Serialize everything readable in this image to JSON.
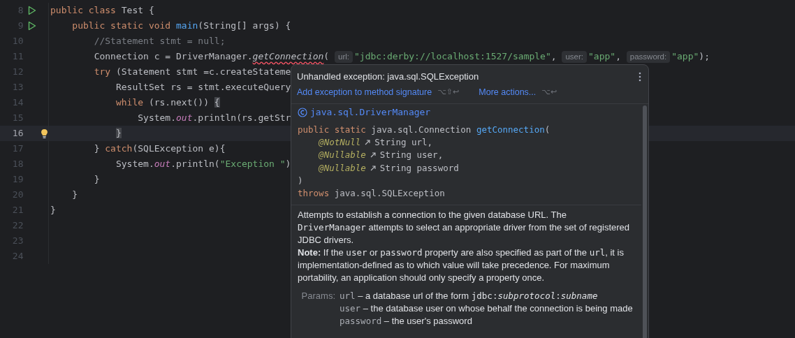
{
  "editor": {
    "lines": [
      {
        "number": "8",
        "run": true,
        "current": false,
        "bulb": false,
        "chunks": [
          {
            "kind": "code",
            "tokens": [
              {
                "text": "public class",
                "kind": "keyword"
              },
              {
                "text": " Test {",
                "kind": "plain"
              }
            ]
          }
        ]
      },
      {
        "number": "9",
        "run": true,
        "current": false,
        "bulb": false,
        "chunks": [
          {
            "kind": "code",
            "tokens": [
              {
                "text": "    public static void",
                "kind": "keyword"
              },
              {
                "text": " main",
                "kind": "method"
              },
              {
                "text": "(String[] args) {",
                "kind": "plain"
              }
            ]
          }
        ]
      },
      {
        "number": "10",
        "run": false,
        "current": false,
        "bulb": false,
        "chunks": [
          {
            "kind": "code",
            "tokens": [
              {
                "text": "        //Statement stmt = null;",
                "kind": "comment"
              }
            ]
          }
        ]
      },
      {
        "number": "11",
        "run": false,
        "current": false,
        "bulb": false,
        "chunks": [
          {
            "kind": "code",
            "tokens": [
              {
                "text": "        Connection c = DriverManager.",
                "kind": "plain"
              },
              {
                "text": "getConnection",
                "kind": "error"
              },
              {
                "text": "(",
                "kind": "plain"
              }
            ]
          },
          {
            "kind": "hint",
            "text": "url:"
          },
          {
            "kind": "code",
            "tokens": [
              {
                "text": "\"jdbc:derby://localhost:1527/sample\"",
                "kind": "string"
              },
              {
                "text": ",",
                "kind": "plain"
              }
            ]
          },
          {
            "kind": "hint",
            "text": "user:"
          },
          {
            "kind": "code",
            "tokens": [
              {
                "text": "\"app\"",
                "kind": "string"
              },
              {
                "text": ",",
                "kind": "plain"
              }
            ]
          },
          {
            "kind": "hint",
            "text": "password:"
          },
          {
            "kind": "code",
            "tokens": [
              {
                "text": "\"app\"",
                "kind": "string"
              },
              {
                "text": ");",
                "kind": "plain"
              }
            ]
          }
        ]
      },
      {
        "number": "12",
        "run": false,
        "current": false,
        "bulb": false,
        "chunks": [
          {
            "kind": "code",
            "tokens": [
              {
                "text": "        try",
                "kind": "keyword"
              },
              {
                "text": " (Statement stmt =c.createStateme",
                "kind": "plain"
              }
            ]
          }
        ]
      },
      {
        "number": "13",
        "run": false,
        "current": false,
        "bulb": false,
        "chunks": [
          {
            "kind": "code",
            "tokens": [
              {
                "text": "            ResultSet rs = stmt.executeQuery",
                "kind": "plain"
              }
            ]
          }
        ]
      },
      {
        "number": "14",
        "run": false,
        "current": false,
        "bulb": false,
        "chunks": [
          {
            "kind": "code",
            "tokens": [
              {
                "text": "            while",
                "kind": "keyword"
              },
              {
                "text": " (rs.next()) ",
                "kind": "plain"
              },
              {
                "text": "{",
                "kind": "brace_match"
              }
            ]
          }
        ]
      },
      {
        "number": "15",
        "run": false,
        "current": false,
        "bulb": false,
        "chunks": [
          {
            "kind": "code",
            "tokens": [
              {
                "text": "                System.",
                "kind": "plain"
              },
              {
                "text": "out",
                "kind": "static_field"
              },
              {
                "text": ".println(rs.getStr",
                "kind": "plain"
              }
            ]
          }
        ]
      },
      {
        "number": "16",
        "run": false,
        "current": true,
        "bulb": true,
        "chunks": [
          {
            "kind": "code",
            "tokens": [
              {
                "text": "            }",
                "kind": "brace_match"
              }
            ]
          }
        ]
      },
      {
        "number": "17",
        "run": false,
        "current": false,
        "bulb": false,
        "chunks": [
          {
            "kind": "code",
            "tokens": [
              {
                "text": "        } ",
                "kind": "plain"
              },
              {
                "text": "catch",
                "kind": "keyword"
              },
              {
                "text": "(SQLException e){",
                "kind": "plain"
              }
            ]
          }
        ]
      },
      {
        "number": "18",
        "run": false,
        "current": false,
        "bulb": false,
        "chunks": [
          {
            "kind": "code",
            "tokens": [
              {
                "text": "            System.",
                "kind": "plain"
              },
              {
                "text": "out",
                "kind": "static_field"
              },
              {
                "text": ".println(",
                "kind": "plain"
              },
              {
                "text": "\"Exception \"",
                "kind": "string"
              },
              {
                "text": ")",
                "kind": "plain"
              }
            ]
          }
        ]
      },
      {
        "number": "19",
        "run": false,
        "current": false,
        "bulb": false,
        "chunks": [
          {
            "kind": "code",
            "tokens": [
              {
                "text": "        }",
                "kind": "plain"
              }
            ]
          }
        ]
      },
      {
        "number": "20",
        "run": false,
        "current": false,
        "bulb": false,
        "chunks": [
          {
            "kind": "code",
            "tokens": [
              {
                "text": "    }",
                "kind": "plain"
              }
            ]
          }
        ]
      },
      {
        "number": "21",
        "run": false,
        "current": false,
        "bulb": false,
        "chunks": [
          {
            "kind": "code",
            "tokens": [
              {
                "text": "}",
                "kind": "plain"
              }
            ]
          }
        ]
      },
      {
        "number": "22",
        "run": false,
        "current": false,
        "bulb": false
      },
      {
        "number": "23",
        "run": false,
        "current": false,
        "bulb": false
      },
      {
        "number": "24",
        "run": false,
        "current": false,
        "bulb": false
      }
    ]
  },
  "popup": {
    "title": "Unhandled exception: java.sql.SQLException",
    "actions": [
      {
        "label": "Add exception to method signature",
        "shortcut": "⌥⇧↩"
      },
      {
        "label": "More actions...",
        "shortcut": "⌥↩"
      }
    ],
    "class_name": "java.sql.DriverManager",
    "signature": [
      [
        {
          "kind": "code",
          "tokens": [
            {
              "text": "public static",
              "kind": "keyword"
            },
            {
              "text": " java.sql.Connection ",
              "kind": "plain"
            },
            {
              "text": "getConnection",
              "kind": "method"
            },
            {
              "text": "(",
              "kind": "plain"
            }
          ]
        }
      ],
      [
        {
          "kind": "code",
          "tokens": [
            {
              "text": "    @NotNull",
              "kind": "annotation"
            }
          ]
        },
        {
          "kind": "link"
        },
        {
          "kind": "code",
          "tokens": [
            {
              "text": "String url,",
              "kind": "plain"
            }
          ]
        }
      ],
      [
        {
          "kind": "code",
          "tokens": [
            {
              "text": "    @Nullable",
              "kind": "annotation"
            }
          ]
        },
        {
          "kind": "link"
        },
        {
          "kind": "code",
          "tokens": [
            {
              "text": "String user,",
              "kind": "plain"
            }
          ]
        }
      ],
      [
        {
          "kind": "code",
          "tokens": [
            {
              "text": "    @Nullable",
              "kind": "annotation"
            }
          ]
        },
        {
          "kind": "link"
        },
        {
          "kind": "code",
          "tokens": [
            {
              "text": "String password",
              "kind": "plain"
            }
          ]
        }
      ],
      [
        {
          "kind": "code",
          "tokens": [
            {
              "text": ")",
              "kind": "plain"
            }
          ]
        }
      ],
      [
        {
          "kind": "code",
          "tokens": [
            {
              "text": "throws",
              "kind": "keyword"
            },
            {
              "text": " java.sql.SQLException",
              "kind": "plain"
            }
          ]
        }
      ]
    ],
    "paragraphs": [
      [
        {
          "kind": "text",
          "text": "Attempts to establish a connection to the given database URL. The "
        },
        {
          "kind": "code",
          "text": "DriverManager"
        },
        {
          "kind": "text",
          "text": " attempts to select an appropriate driver from the set of registered JDBC drivers."
        }
      ],
      [
        {
          "kind": "bold",
          "text": "Note:"
        },
        {
          "kind": "text",
          "text": " If the "
        },
        {
          "kind": "code",
          "text": "user"
        },
        {
          "kind": "text",
          "text": " or "
        },
        {
          "kind": "code",
          "text": "password"
        },
        {
          "kind": "text",
          "text": " property are also specified as part of the "
        },
        {
          "kind": "code",
          "text": "url"
        },
        {
          "kind": "text",
          "text": ", it is implementation-defined as to which value will take precedence. For maximum portability, an application should only specify a property once."
        }
      ]
    ],
    "params_label": "Params:",
    "params": [
      {
        "name": "url",
        "segments": [
          {
            "kind": "text",
            "text": " – a database url of the form "
          },
          {
            "kind": "code",
            "text": "jdbc:"
          },
          {
            "kind": "code_italic",
            "text": "subprotocol"
          },
          {
            "kind": "code",
            "text": ":"
          },
          {
            "kind": "code_italic",
            "text": "subname"
          }
        ]
      },
      {
        "name": "user",
        "segments": [
          {
            "kind": "text",
            "text": " – the database user on whose behalf the connection is being made"
          }
        ]
      },
      {
        "name": "password",
        "segments": [
          {
            "kind": "text",
            "text": " – the user's password"
          }
        ]
      }
    ]
  }
}
